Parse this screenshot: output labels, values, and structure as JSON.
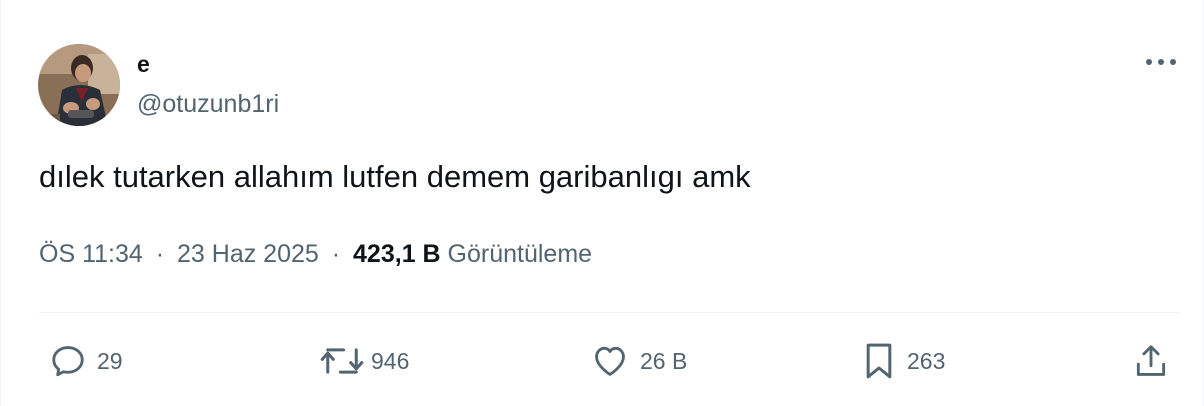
{
  "author": {
    "name": "e",
    "handle": "@otuzunb1ri"
  },
  "tweet": {
    "text": "dılek tutarken allahım lutfen demem garibanlıgı amk"
  },
  "meta": {
    "time": "ÖS 11:34",
    "separator": "·",
    "date": "23 Haz 2025",
    "views_count": "423,1 B",
    "views_label": "Görüntüleme"
  },
  "actions": {
    "replies": "29",
    "reposts": "946",
    "likes": "26 B",
    "bookmarks": "263"
  },
  "icons": {
    "more": "more-horizontal-icon",
    "reply": "reply-icon",
    "repost": "repost-icon",
    "like": "heart-icon",
    "bookmark": "bookmark-icon",
    "share": "share-icon"
  },
  "colors": {
    "text": "#0f1419",
    "secondary": "#536471",
    "divider": "#eff3f4"
  }
}
